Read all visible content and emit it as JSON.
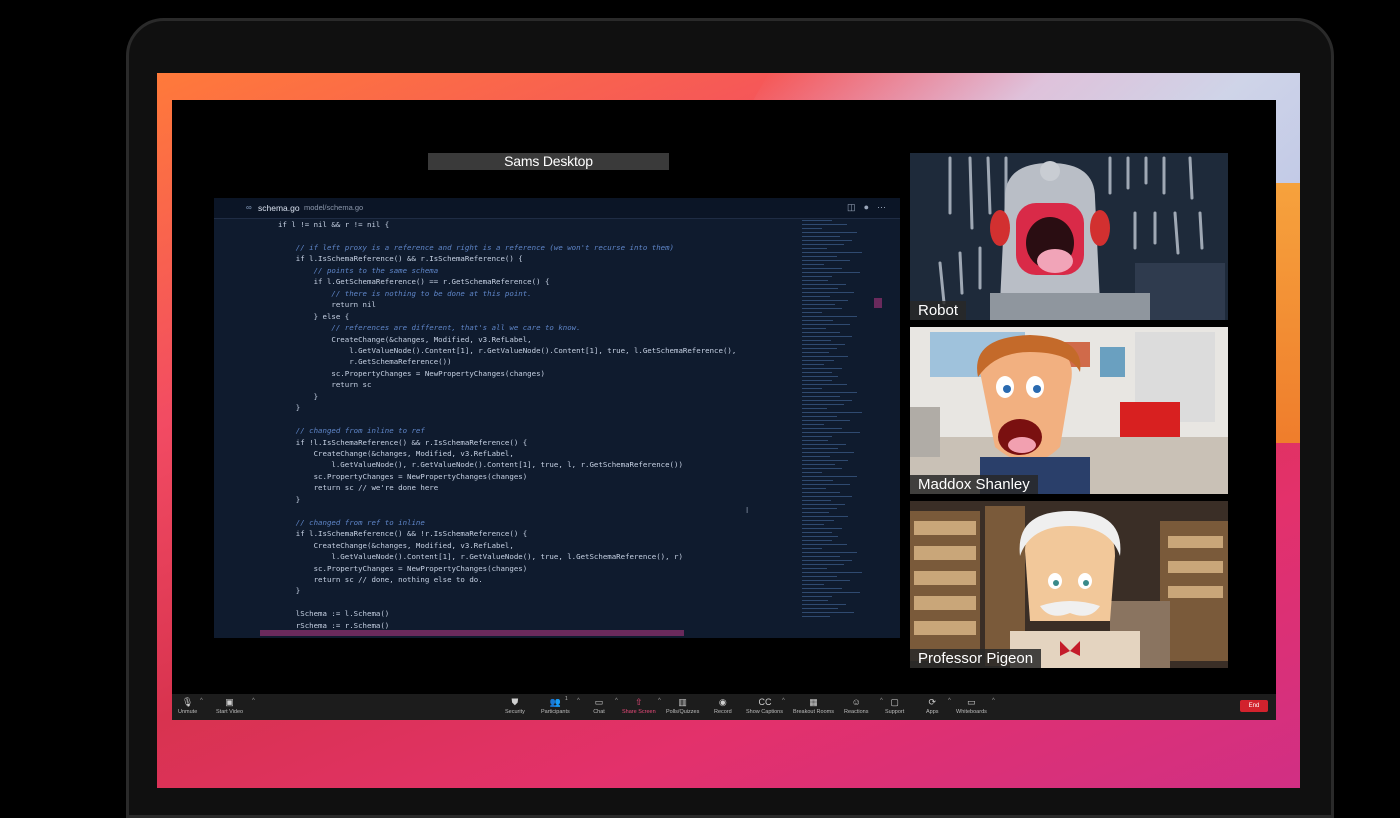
{
  "meeting": {
    "share_label": "Sams Desktop",
    "participants": [
      {
        "name": "Robot"
      },
      {
        "name": "Maddox Shanley"
      },
      {
        "name": "Professor Pigeon"
      }
    ]
  },
  "editor": {
    "tab_name": "schema.go",
    "tab_path": "model/schema.go",
    "code_lines": [
      "if l != nil && r != nil {",
      "",
      "    // if left proxy is a reference and right is a reference (we won't recurse into them)",
      "    if l.IsSchemaReference() && r.IsSchemaReference() {",
      "        // points to the same schema",
      "        if l.GetSchemaReference() == r.GetSchemaReference() {",
      "            // there is nothing to be done at this point.",
      "            return nil",
      "        } else {",
      "            // references are different, that's all we care to know.",
      "            CreateChange(&changes, Modified, v3.RefLabel,",
      "                l.GetValueNode().Content[1], r.GetValueNode().Content[1], true, l.GetSchemaReference(),",
      "                r.GetSchemaReference())",
      "            sc.PropertyChanges = NewPropertyChanges(changes)",
      "            return sc",
      "        }",
      "    }",
      "",
      "    // changed from inline to ref",
      "    if !l.IsSchemaReference() && r.IsSchemaReference() {",
      "        CreateChange(&changes, Modified, v3.RefLabel,",
      "            l.GetValueNode(), r.GetValueNode().Content[1], true, l, r.GetSchemaReference())",
      "        sc.PropertyChanges = NewPropertyChanges(changes)",
      "        return sc // we're done here",
      "    }",
      "",
      "    // changed from ref to inline",
      "    if l.IsSchemaReference() && !r.IsSchemaReference() {",
      "        CreateChange(&changes, Modified, v3.RefLabel,",
      "            l.GetValueNode().Content[1], r.GetValueNode(), true, l.GetSchemaReference(), r)",
      "        sc.PropertyChanges = NewPropertyChanges(changes)",
      "        return sc // done, nothing else to do.",
      "    }",
      "",
      "    lSchema := l.Schema()",
      "    rSchema := r.Schema()"
    ]
  },
  "toolbar": {
    "items": [
      {
        "label": "Unmute",
        "icon": "mic-off-icon"
      },
      {
        "label": "Start Video",
        "icon": "video-off-icon"
      },
      {
        "label": "Security",
        "icon": "shield-icon"
      },
      {
        "label": "Participants",
        "icon": "participants-icon",
        "count": "1"
      },
      {
        "label": "Chat",
        "icon": "chat-icon"
      },
      {
        "label": "Share Screen",
        "icon": "share-screen-icon",
        "color": "#e84a7a"
      },
      {
        "label": "Polls/Quizzes",
        "icon": "poll-icon"
      },
      {
        "label": "Record",
        "icon": "record-icon"
      },
      {
        "label": "Show Captions",
        "icon": "captions-icon"
      },
      {
        "label": "Breakout Rooms",
        "icon": "breakout-icon"
      },
      {
        "label": "Reactions",
        "icon": "reactions-icon"
      },
      {
        "label": "Support",
        "icon": "support-icon"
      },
      {
        "label": "Apps",
        "icon": "apps-icon"
      },
      {
        "label": "Whiteboards",
        "icon": "whiteboard-icon"
      }
    ],
    "end_label": "End"
  },
  "colors": {
    "end": "#d2222d",
    "share_active": "#e84a7a",
    "code_bg": "#0f1b2e"
  }
}
